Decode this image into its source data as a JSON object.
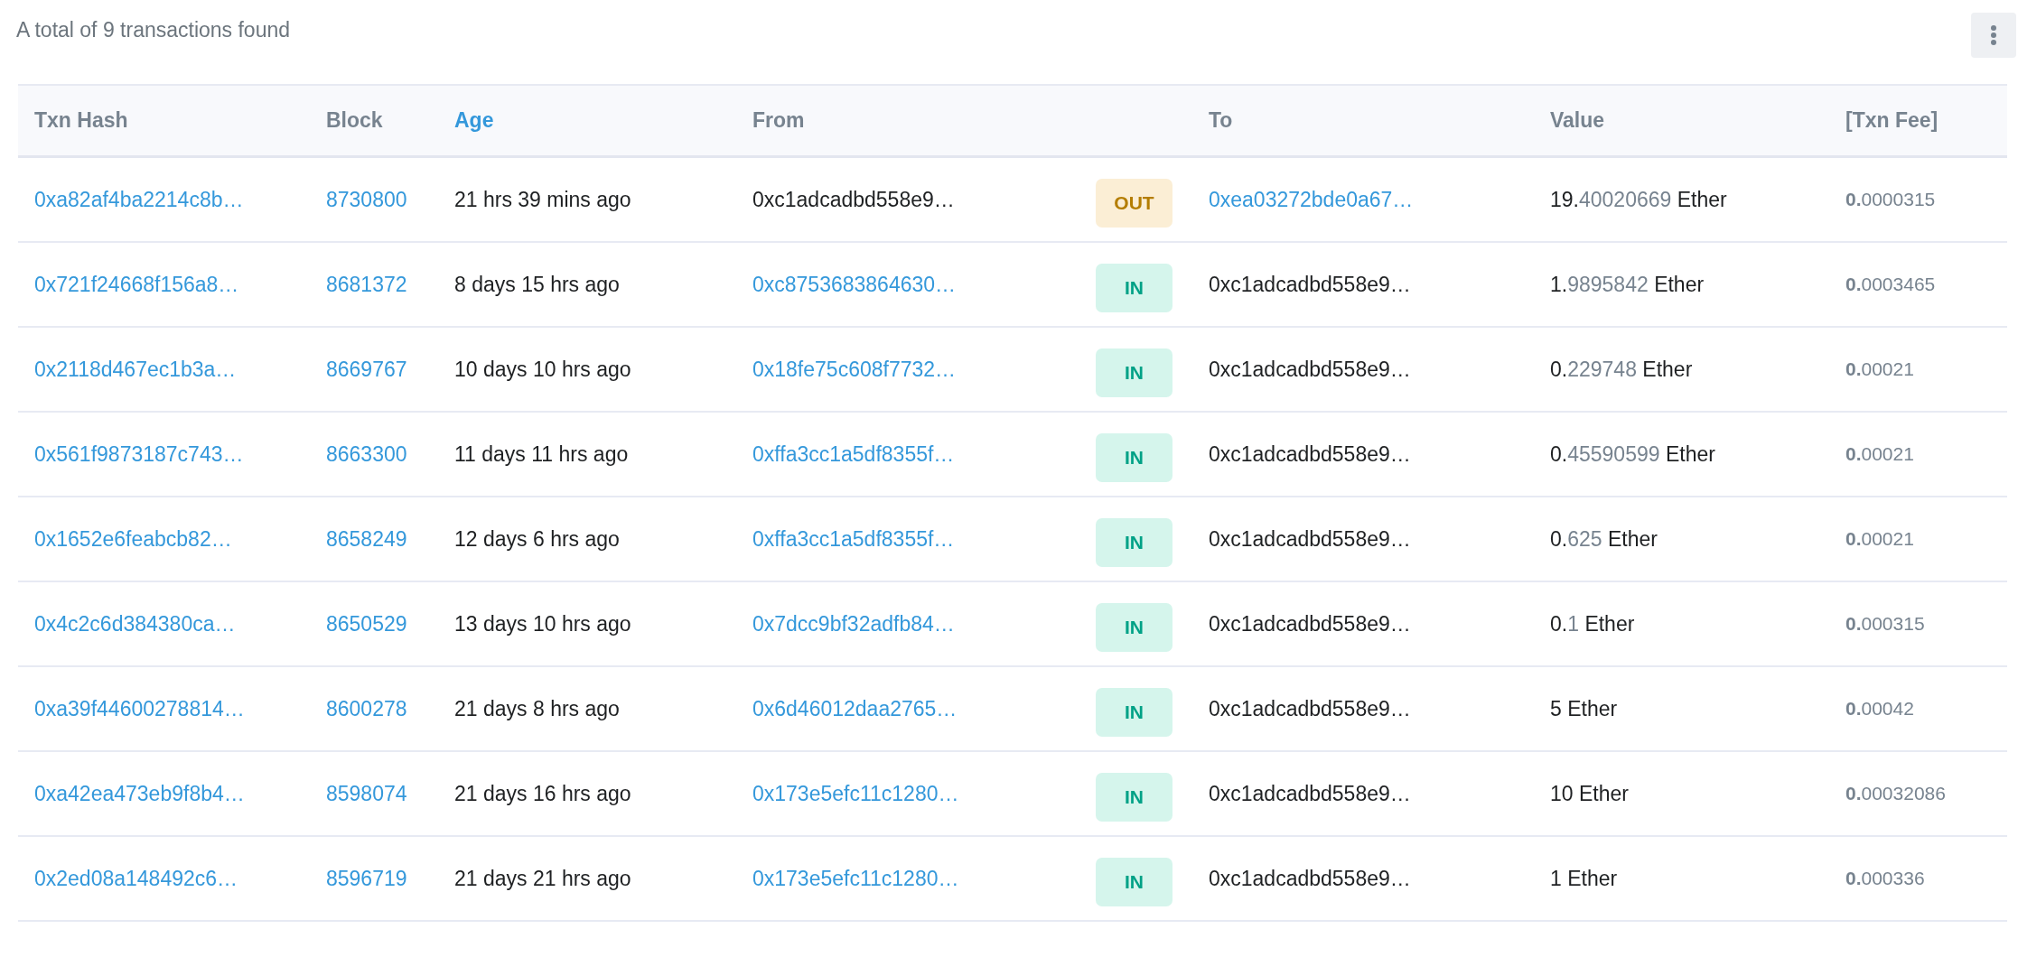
{
  "summary": "A total of 9 transactions found",
  "columns": [
    {
      "label": "Txn Hash",
      "sorted": false
    },
    {
      "label": "Block",
      "sorted": false
    },
    {
      "label": "Age",
      "sorted": true
    },
    {
      "label": "From",
      "sorted": false
    },
    {
      "label": "To",
      "sorted": false
    },
    {
      "label": "Value",
      "sorted": false
    },
    {
      "label": "[Txn Fee]",
      "sorted": false
    }
  ],
  "rows": [
    {
      "hash": "0xa82af4ba2214c8b…",
      "block": "8730800",
      "age": "21 hrs 39 mins ago",
      "from": {
        "text": "0xc1adcadbd558e9…",
        "link": false
      },
      "direction": {
        "label": "OUT",
        "kind": "out"
      },
      "to": {
        "text": "0xea03272bde0a67…",
        "link": true
      },
      "value": {
        "whole": "19.",
        "decimals": "40020669",
        "unit": "Ether"
      },
      "fee": "**0.**0000315"
    },
    {
      "hash": "0x721f24668f156a8…",
      "block": "8681372",
      "age": "8 days 15 hrs ago",
      "from": {
        "text": "0xc8753683864630…",
        "link": true
      },
      "direction": {
        "label": "IN",
        "kind": "in"
      },
      "to": {
        "text": "0xc1adcadbd558e9…",
        "link": false
      },
      "value": {
        "whole": "1.",
        "decimals": "9895842",
        "unit": "Ether"
      },
      "fee": "**0.**0003465"
    },
    {
      "hash": "0x2118d467ec1b3a…",
      "block": "8669767",
      "age": "10 days 10 hrs ago",
      "from": {
        "text": "0x18fe75c608f7732…",
        "link": true
      },
      "direction": {
        "label": "IN",
        "kind": "in"
      },
      "to": {
        "text": "0xc1adcadbd558e9…",
        "link": false
      },
      "value": {
        "whole": "0.",
        "decimals": "229748",
        "unit": "Ether"
      },
      "fee": "**0.**00021"
    },
    {
      "hash": "0x561f9873187c743…",
      "block": "8663300",
      "age": "11 days 11 hrs ago",
      "from": {
        "text": "0xffa3cc1a5df8355f…",
        "link": true
      },
      "direction": {
        "label": "IN",
        "kind": "in"
      },
      "to": {
        "text": "0xc1adcadbd558e9…",
        "link": false
      },
      "value": {
        "whole": "0.",
        "decimals": "45590599",
        "unit": "Ether"
      },
      "fee": "**0.**00021"
    },
    {
      "hash": "0x1652e6feabcb82…",
      "block": "8658249",
      "age": "12 days 6 hrs ago",
      "from": {
        "text": "0xffa3cc1a5df8355f…",
        "link": true
      },
      "direction": {
        "label": "IN",
        "kind": "in"
      },
      "to": {
        "text": "0xc1adcadbd558e9…",
        "link": false
      },
      "value": {
        "whole": "0.",
        "decimals": "625",
        "unit": "Ether"
      },
      "fee": "**0.**00021"
    },
    {
      "hash": "0x4c2c6d384380ca…",
      "block": "8650529",
      "age": "13 days 10 hrs ago",
      "from": {
        "text": "0x7dcc9bf32adfb84…",
        "link": true
      },
      "direction": {
        "label": "IN",
        "kind": "in"
      },
      "to": {
        "text": "0xc1adcadbd558e9…",
        "link": false
      },
      "value": {
        "whole": "0.",
        "decimals": "1",
        "unit": "Ether"
      },
      "fee": "**0.**000315"
    },
    {
      "hash": "0xa39f44600278814…",
      "block": "8600278",
      "age": "21 days 8 hrs ago",
      "from": {
        "text": "0x6d46012daa2765…",
        "link": true
      },
      "direction": {
        "label": "IN",
        "kind": "in"
      },
      "to": {
        "text": "0xc1adcadbd558e9…",
        "link": false
      },
      "value": {
        "whole": "5",
        "unit": "Ether"
      },
      "fee": "**0.**00042"
    },
    {
      "hash": "0xa42ea473eb9f8b4…",
      "block": "8598074",
      "age": "21 days 16 hrs ago",
      "from": {
        "text": "0x173e5efc11c1280…",
        "link": true
      },
      "direction": {
        "label": "IN",
        "kind": "in"
      },
      "to": {
        "text": "0xc1adcadbd558e9…",
        "link": false
      },
      "value": {
        "whole": "10",
        "unit": "Ether"
      },
      "fee": "**0.**00032086"
    },
    {
      "hash": "0x2ed08a148492c6…",
      "block": "8596719",
      "age": "21 days 21 hrs ago",
      "from": {
        "text": "0x173e5efc11c1280…",
        "link": true
      },
      "direction": {
        "label": "IN",
        "kind": "in"
      },
      "to": {
        "text": "0xc1adcadbd558e9…",
        "link": false
      },
      "value": {
        "whole": "1",
        "unit": "Ether"
      },
      "fee": "**0.**000336"
    }
  ]
}
